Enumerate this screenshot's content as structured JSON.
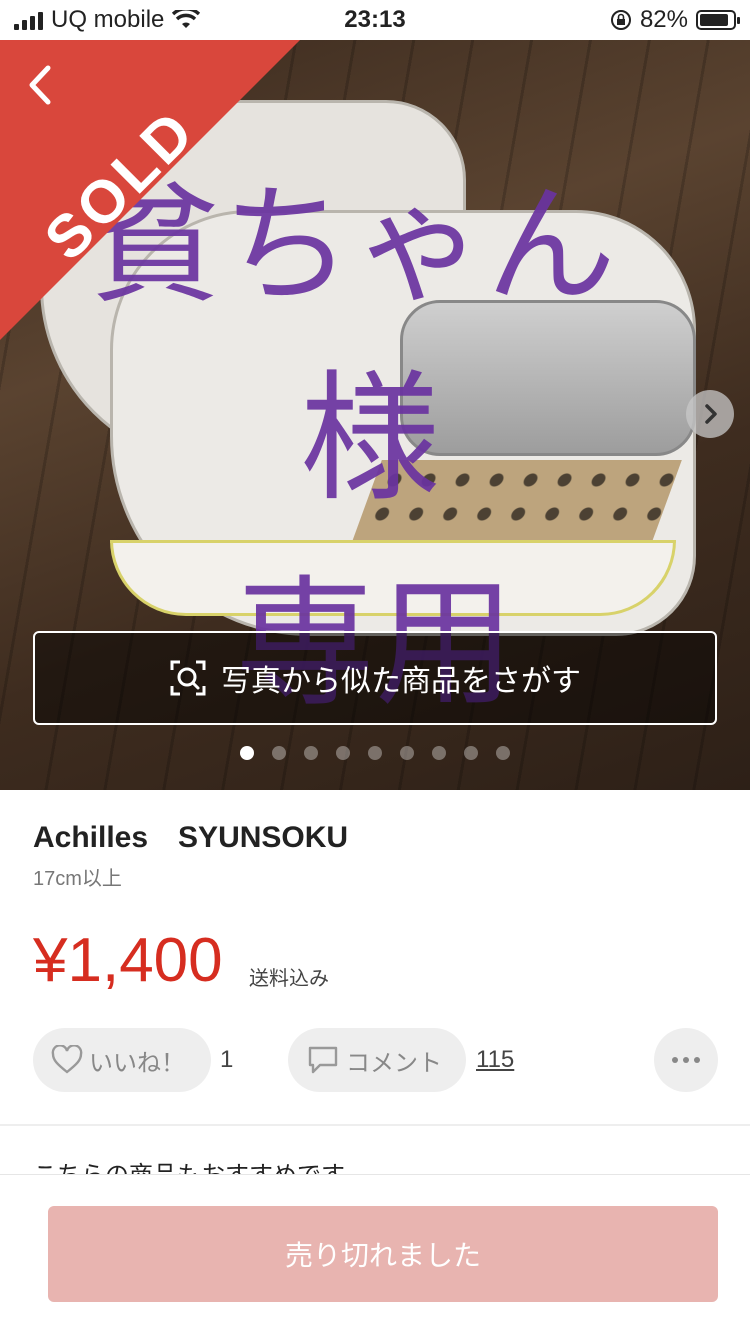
{
  "status_bar": {
    "carrier": "UQ mobile",
    "time": "23:13",
    "battery": "82%"
  },
  "hero": {
    "sold_label": "SOLD",
    "overlay_line1": "貧ちゃん",
    "overlay_line2": "様",
    "overlay_line3": "専用",
    "photo_search_label": "写真から似た商品をさがす",
    "page_count": 9,
    "active_page": 1
  },
  "product": {
    "title": "Achilles　SYUNSOKU",
    "size": "17cm以上",
    "price": "¥1,400",
    "shipping": "送料込み"
  },
  "actions": {
    "like_label": "いいね！",
    "like_count": "1",
    "comment_label": "コメント",
    "comment_count": "115"
  },
  "recommend_text": "こちらの商品もおすすめです",
  "bottom": {
    "soldout_label": "売り切れました"
  },
  "colors": {
    "price": "#d62d20",
    "sold_ribbon": "#d9473c",
    "soldout_button": "#e8b4b0"
  }
}
